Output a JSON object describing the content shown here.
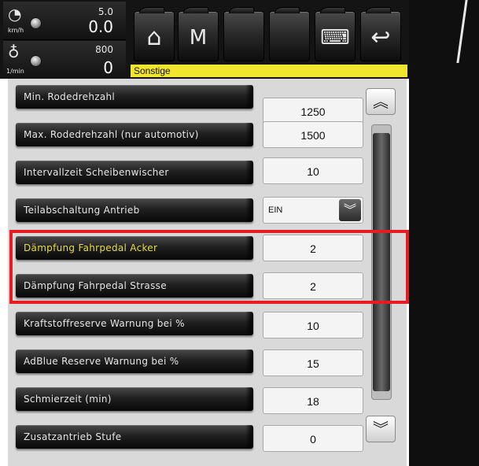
{
  "header": {
    "speed_gauge": {
      "icon": "speedometer-icon",
      "unit": "km/h",
      "max": "5.0",
      "value": "0.0"
    },
    "rpm_gauge": {
      "icon": "engine-icon",
      "unit": "1/min",
      "max": "800",
      "value": "0"
    },
    "toolbar_buttons": [
      {
        "name": "home-icon",
        "glyph": "⌂"
      },
      {
        "name": "menu-m-icon",
        "glyph": "M"
      },
      {
        "name": "empty-slot-1",
        "glyph": ""
      },
      {
        "name": "empty-slot-2",
        "glyph": ""
      },
      {
        "name": "keyboard-icon",
        "glyph": "⌨"
      },
      {
        "name": "back-icon",
        "glyph": "↩"
      }
    ],
    "status_text": "Sonstige"
  },
  "settings": [
    {
      "label": "Min. Rodedrehzahl",
      "value": "1250"
    },
    {
      "label": "Max. Rodedrehzahl (nur automotiv)",
      "value": "1500"
    },
    {
      "label": "Intervallzeit Scheibenwischer",
      "value": "10"
    },
    {
      "label": "Teilabschaltung Antrieb",
      "value": "EIN",
      "type": "select"
    },
    {
      "label": "Dämpfung Fahrpedal Acker",
      "value": "2",
      "selected": true
    },
    {
      "label": "Dämpfung Fahrpedal Strasse",
      "value": "2"
    },
    {
      "label": "Kraftstoffreserve Warnung bei %",
      "value": "10"
    },
    {
      "label": "AdBlue Reserve Warnung bei %",
      "value": "15"
    },
    {
      "label": "Schmierzeit (min)",
      "value": "18"
    },
    {
      "label": "Zusatzantrieb Stufe",
      "value": "0"
    }
  ],
  "scrollbar": {
    "up_icon": "double-chevron-up-icon",
    "down_icon": "double-chevron-down-icon"
  },
  "colors": {
    "status_yellow": "#f2e52f",
    "highlight_red": "#e51c23",
    "selected_text": "#e8de3a"
  }
}
